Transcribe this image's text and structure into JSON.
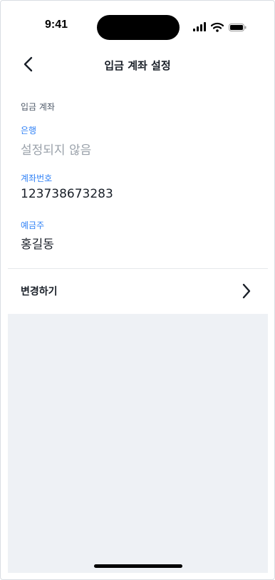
{
  "status_bar": {
    "time": "9:41"
  },
  "nav": {
    "title": "입금 계좌 설정"
  },
  "account": {
    "section_title": "입금 계좌",
    "bank": {
      "label": "은행",
      "value": "설정되지 않음"
    },
    "account_number": {
      "label": "계좌번호",
      "value": "123738673283"
    },
    "holder": {
      "label": "예금주",
      "value": "홍길동"
    }
  },
  "change": {
    "label": "변경하기"
  },
  "colors": {
    "accent": "#3182f6",
    "muted": "#9aa1aa",
    "background_gray": "#eef1f5"
  }
}
